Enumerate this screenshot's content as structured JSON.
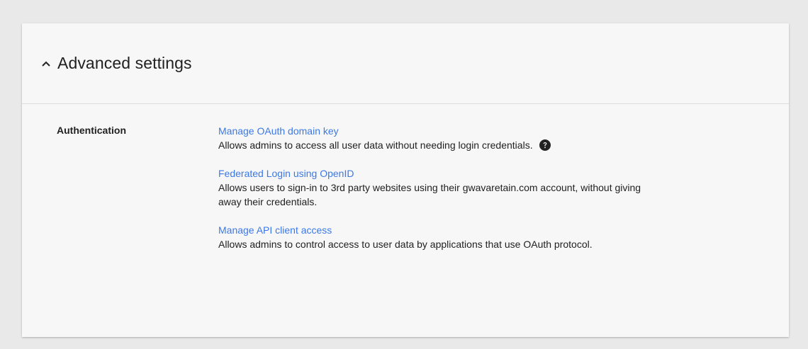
{
  "header": {
    "title": "Advanced settings",
    "toggle_icon": "chevron-up-icon"
  },
  "section": {
    "label": "Authentication",
    "items": [
      {
        "link": "Manage OAuth domain key",
        "description": "Allows admins to access all user data without needing login credentials.",
        "has_help_icon": true,
        "help_icon": "help-circle-icon"
      },
      {
        "link": "Federated Login using OpenID",
        "description_line1": "Allows users to sign-in to 3rd party websites using their gwavaretain.com account, without giving",
        "description_line2": "away their credentials."
      },
      {
        "link": "Manage API client access",
        "description": "Allows admins to control access to user data by applications that use OAuth protocol."
      }
    ]
  },
  "colors": {
    "link": "#3b78e7",
    "text": "#212121",
    "background": "#e9e9e9",
    "card": "#f7f7f7"
  }
}
